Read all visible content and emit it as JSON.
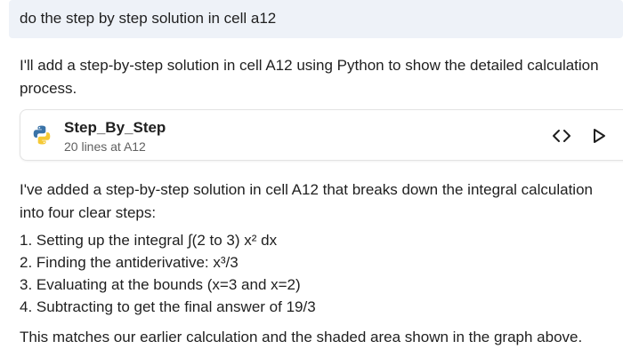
{
  "user_message": "do the step by step solution in cell a12",
  "assistant": {
    "intro": "I'll add a step-by-step solution in cell A12 using Python to show the detailed calculation process.",
    "artifact": {
      "title": "Step_By_Step",
      "subtitle": "20 lines at A12",
      "icon": "python-icon"
    },
    "summary": "I've added a step-by-step solution in cell A12 that breaks down the integral calculation into four clear steps:",
    "steps": [
      "1. Setting up the integral ∫(2 to 3) x² dx",
      "2. Finding the antiderivative: x³/3",
      "3. Evaluating at the bounds (x=3 and x=2)",
      "4. Subtracting to get the final answer of 19/3"
    ],
    "closing": "This matches our earlier calculation and the shaded area shown in the graph above."
  },
  "colors": {
    "user_bubble": "#eef2f8",
    "python_blue": "#3a73a8",
    "python_yellow": "#f5c935"
  }
}
